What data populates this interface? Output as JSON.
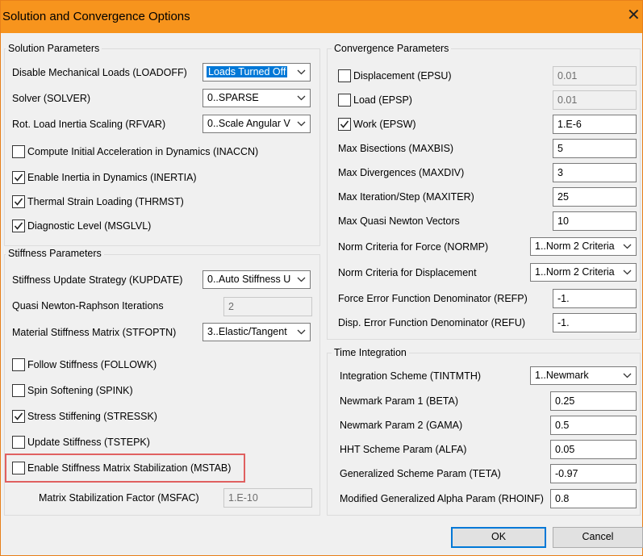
{
  "window": {
    "title": "Solution and Convergence Options"
  },
  "solution": {
    "group_title": "Solution Parameters",
    "loadoff": {
      "label": "Disable Mechanical Loads (LOADOFF)",
      "value": "Loads Turned Off"
    },
    "solver": {
      "label": "Solver (SOLVER)",
      "value": "0..SPARSE"
    },
    "rfvar": {
      "label": "Rot. Load Inertia Scaling (RFVAR)",
      "value": "0..Scale Angular V"
    },
    "inaccn": {
      "label": "Compute Initial Acceleration in Dynamics (INACCN)",
      "checked": false
    },
    "inertia": {
      "label": "Enable Inertia in Dynamics (INERTIA)",
      "checked": true
    },
    "thrmst": {
      "label": "Thermal Strain Loading (THRMST)",
      "checked": true
    },
    "msglvl": {
      "label": "Diagnostic Level (MSGLVL)",
      "checked": true
    }
  },
  "stiffness": {
    "group_title": "Stiffness Parameters",
    "kupdate": {
      "label": "Stiffness Update Strategy (KUPDATE)",
      "value": "0..Auto Stiffness U"
    },
    "qnr": {
      "label": "Quasi Newton-Raphson Iterations",
      "value": "2"
    },
    "stfoptn": {
      "label": "Material Stiffness Matrix (STFOPTN)",
      "value": "3..Elastic/Tangent"
    },
    "followk": {
      "label": "Follow Stiffness (FOLLOWK)",
      "checked": false
    },
    "spink": {
      "label": "Spin Softening (SPINK)",
      "checked": false
    },
    "stressk": {
      "label": "Stress Stiffening (STRESSK)",
      "checked": true
    },
    "tstepk": {
      "label": "Update Stiffness (TSTEPK)",
      "checked": false
    },
    "mstab": {
      "label": "Enable Stiffness Matrix Stabilization (MSTAB)",
      "checked": false
    },
    "msfac": {
      "label": "Matrix Stabilization Factor (MSFAC)",
      "value": "1.E-10"
    }
  },
  "convergence": {
    "group_title": "Convergence Parameters",
    "epsu": {
      "label": "Displacement (EPSU)",
      "checked": false,
      "value": "0.01"
    },
    "epsp": {
      "label": "Load (EPSP)",
      "checked": false,
      "value": "0.01"
    },
    "epsw": {
      "label": "Work (EPSW)",
      "checked": true,
      "value": "1.E-6"
    },
    "maxbis": {
      "label": "Max Bisections (MAXBIS)",
      "value": "5"
    },
    "maxdiv": {
      "label": "Max Divergences (MAXDIV)",
      "value": "3"
    },
    "maxiter": {
      "label": "Max Iteration/Step (MAXITER)",
      "value": "25"
    },
    "maxqnv": {
      "label": "Max Quasi Newton Vectors",
      "value": "10"
    },
    "normp": {
      "label": "Norm Criteria for Force (NORMP)",
      "value": "1..Norm 2 Criteria"
    },
    "normd": {
      "label": "Norm Criteria for Displacement",
      "value": "1..Norm 2 Criteria"
    },
    "refp": {
      "label": "Force Error Function Denominator (REFP)",
      "value": "-1."
    },
    "refu": {
      "label": "Disp. Error Function Denominator (REFU)",
      "value": "-1."
    }
  },
  "time": {
    "group_title": "Time Integration",
    "tintmth": {
      "label": "Integration Scheme (TINTMTH)",
      "value": "1..Newmark"
    },
    "beta": {
      "label": "Newmark Param 1 (BETA)",
      "value": "0.25"
    },
    "gama": {
      "label": "Newmark Param 2 (GAMA)",
      "value": "0.5"
    },
    "alfa": {
      "label": "HHT Scheme Param (ALFA)",
      "value": "0.05"
    },
    "teta": {
      "label": "Generalized Scheme Param (TETA)",
      "value": "-0.97"
    },
    "rhoinf": {
      "label": "Modified Generalized Alpha Param (RHOINF)",
      "value": "0.8"
    }
  },
  "buttons": {
    "ok": "OK",
    "cancel": "Cancel"
  },
  "colors": {
    "titlebar": "#f7941d",
    "highlight": "#e06060",
    "accent": "#0078d7"
  }
}
